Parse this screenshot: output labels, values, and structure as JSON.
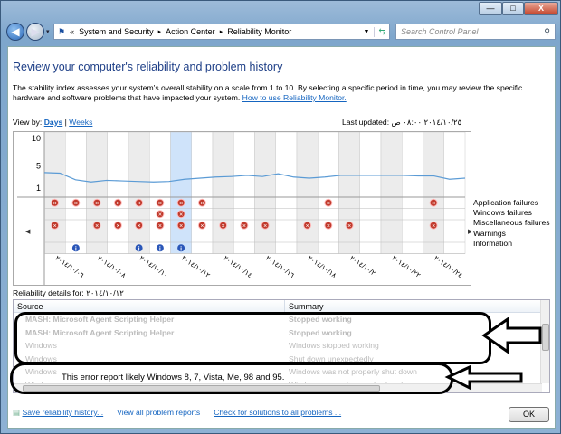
{
  "window": {
    "minimize": "—",
    "maximize": "□",
    "close": "X"
  },
  "breadcrumb": {
    "overflow": "«",
    "items": [
      "System and Security",
      "Action Center",
      "Reliability Monitor"
    ],
    "sep": "▸"
  },
  "search": {
    "placeholder": "Search Control Panel"
  },
  "page": {
    "title": "Review your computer's reliability and problem history",
    "description": "The stability index assesses your system's overall stability on a scale from 1 to 10. By selecting a specific period in time, you may review the specific hardware and software problems that have impacted your system.",
    "help_link": "How to use Reliability Monitor."
  },
  "viewby": {
    "label": "View by:",
    "days": "Days",
    "sep": "|",
    "weeks": "Weeks"
  },
  "last_updated": {
    "label": "Last updated:",
    "value": "٢٠١٤/١٠/٢٥ ٠٨:٠٠ ص"
  },
  "chart_data": {
    "type": "line",
    "title": "Stability index",
    "yticks": [
      "10",
      "5",
      "1"
    ],
    "ylim": [
      1,
      10
    ],
    "columns": 20,
    "selected_column": 6,
    "shaded_columns": [
      0,
      2,
      4,
      8,
      10,
      12,
      14,
      16,
      18
    ],
    "stability": [
      3.8,
      3.7,
      2.5,
      2.1,
      2.4,
      2.3,
      2.2,
      2.1,
      2.2,
      2.6,
      2.8,
      3.0,
      3.1,
      3.3,
      3.1,
      3.6,
      3.0,
      2.8,
      3.0,
      3.3,
      3.3,
      3.3,
      3.3,
      3.3,
      3.2,
      3.2,
      2.6,
      2.8
    ],
    "rows": [
      {
        "name": "Application failures",
        "type": "error",
        "columns": [
          0,
          1,
          2,
          3,
          4,
          5,
          6,
          7,
          13,
          18
        ]
      },
      {
        "name": "Windows failures",
        "type": "error",
        "columns": [
          5,
          6
        ]
      },
      {
        "name": "Miscellaneous failures",
        "type": "error",
        "columns": [
          0,
          2,
          3,
          4,
          5,
          6,
          7,
          8,
          9,
          10,
          12,
          13,
          14,
          18
        ]
      },
      {
        "name": "Warnings",
        "type": "warning",
        "columns": []
      },
      {
        "name": "Information",
        "type": "info",
        "columns": [
          1,
          4,
          5,
          6
        ]
      }
    ],
    "date_labels": [
      "٢٠١٤/١٠/٠٦",
      "٢٠١٤/١٠/٠٨",
      "٢٠١٤/١٠/١٠",
      "٢٠١٤/١٠/١٢",
      "٢٠١٤/١٠/١٤",
      "٢٠١٤/١٠/١٦",
      "٢٠١٤/١٠/١٨",
      "٢٠١٤/١٠/٢٠",
      "٢٠١٤/١٠/٢٢",
      "٢٠١٤/١٠/٢٤"
    ]
  },
  "details": {
    "label": "Reliability details for: ٢٠١٤/١٠/١٢",
    "columns": [
      "Source",
      "Summary"
    ],
    "rows": [
      {
        "source": "MASH: Microsoft Agent Scripting Helper",
        "summary": "Stopped working"
      },
      {
        "source": "MASH: Microsoft Agent Scripting Helper",
        "summary": "Stopped working"
      },
      {
        "source": "Windows",
        "summary": "Windows stopped working"
      },
      {
        "source": "Windows",
        "summary": "Shut down unexpectedly"
      },
      {
        "source": "Windows",
        "summary": "Windows was not properly shut down"
      },
      {
        "source": "Windows",
        "summary": "Windows was not properly shut down"
      }
    ]
  },
  "annotation": "This error report likely Windows 8, 7, Vista, Me, 98 and 95.",
  "footer": {
    "save": "Save reliability history...",
    "view_all": "View all problem reports",
    "check": "Check for solutions to all problems ...",
    "ok": "OK"
  },
  "colors": {
    "accent": "#1e3f87",
    "line": "#5b9bd5",
    "selected": "#cfe3fa",
    "error": "#c0392b",
    "info": "#2a56b8"
  }
}
